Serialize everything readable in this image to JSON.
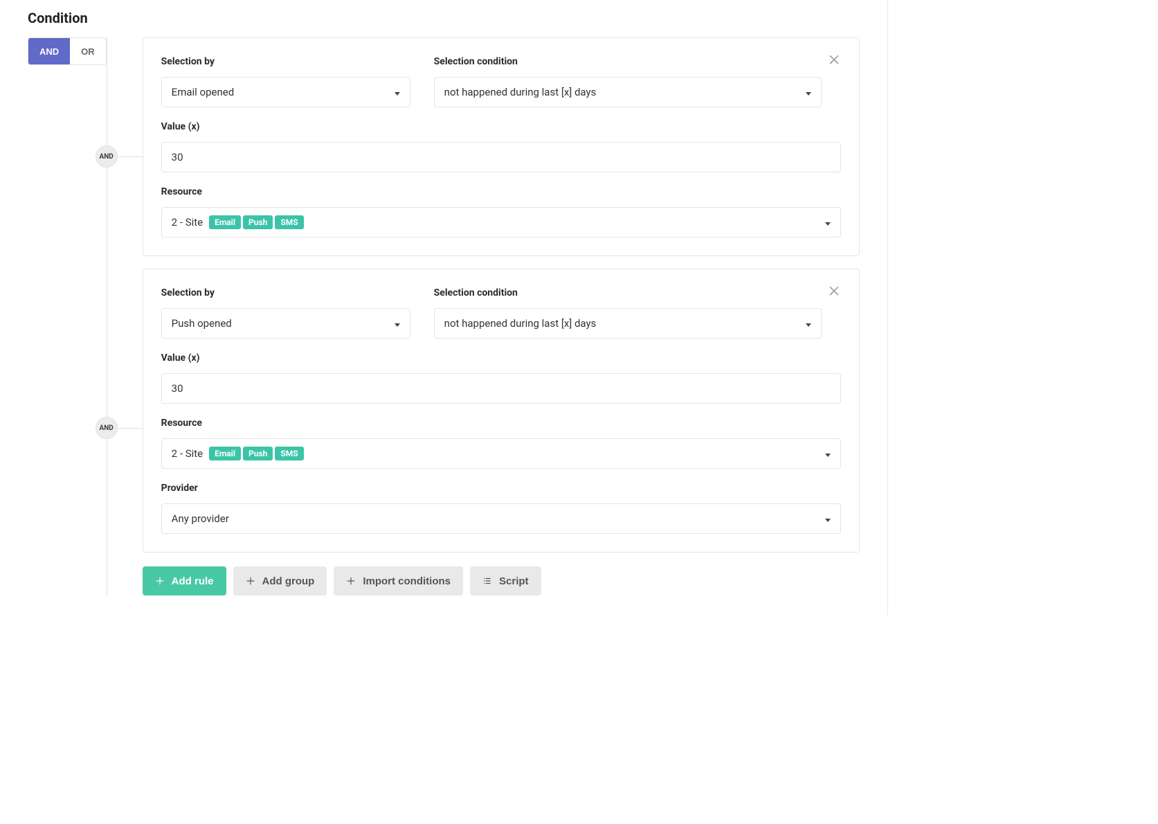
{
  "heading": "Condition",
  "logic_toggle": {
    "and": "AND",
    "or": "OR",
    "active": "AND"
  },
  "connector_label": "AND",
  "rules": [
    {
      "selection_by_label": "Selection by",
      "selection_by_value": "Email opened",
      "selection_condition_label": "Selection condition",
      "selection_condition_value": "not happened during last [x] days",
      "value_label": "Value (x)",
      "value": "30",
      "resource_label": "Resource",
      "resource_prefix": "2 - Site",
      "resource_chips": [
        "Email",
        "Push",
        "SMS"
      ]
    },
    {
      "selection_by_label": "Selection by",
      "selection_by_value": "Push opened",
      "selection_condition_label": "Selection condition",
      "selection_condition_value": "not happened during last [x] days",
      "value_label": "Value (x)",
      "value": "30",
      "resource_label": "Resource",
      "resource_prefix": "2 - Site",
      "resource_chips": [
        "Email",
        "Push",
        "SMS"
      ],
      "provider_label": "Provider",
      "provider_value": "Any provider"
    }
  ],
  "actions": {
    "add_rule": "Add rule",
    "add_group": "Add group",
    "import_conditions": "Import conditions",
    "script": "Script"
  }
}
